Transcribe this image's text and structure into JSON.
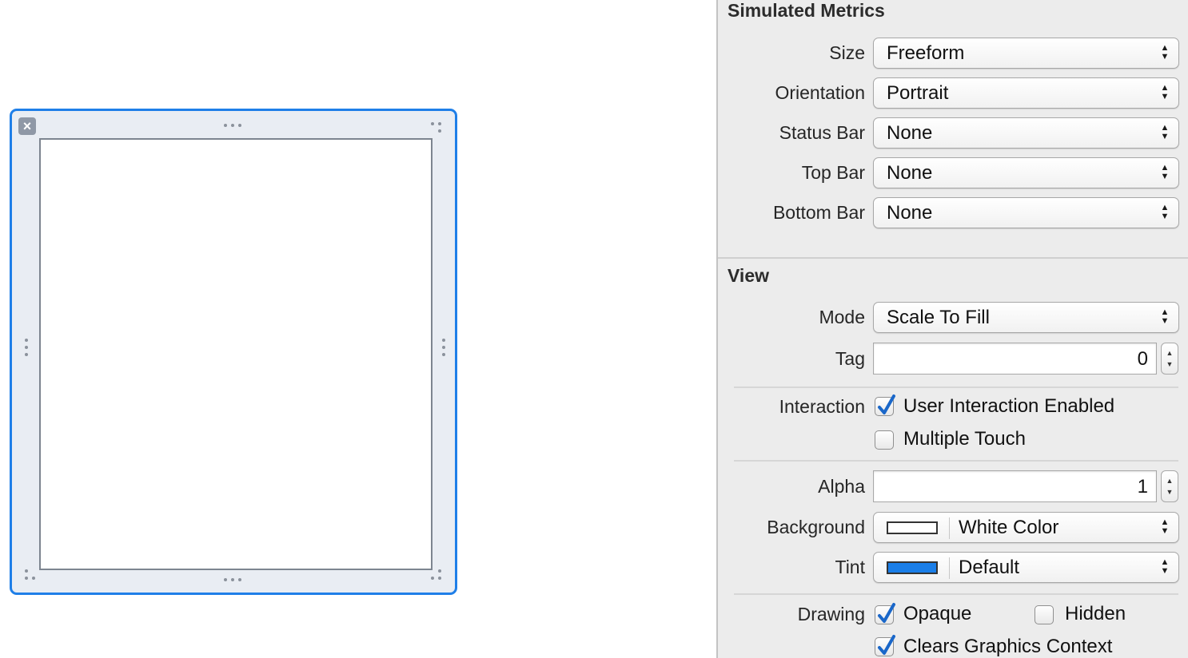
{
  "simulated_metrics": {
    "title": "Simulated Metrics",
    "size": {
      "label": "Size",
      "value": "Freeform"
    },
    "orientation": {
      "label": "Orientation",
      "value": "Portrait"
    },
    "status_bar": {
      "label": "Status Bar",
      "value": "None"
    },
    "top_bar": {
      "label": "Top Bar",
      "value": "None"
    },
    "bottom_bar": {
      "label": "Bottom Bar",
      "value": "None"
    }
  },
  "view": {
    "title": "View",
    "mode": {
      "label": "Mode",
      "value": "Scale To Fill"
    },
    "tag": {
      "label": "Tag",
      "value": "0"
    },
    "interaction": {
      "label": "Interaction",
      "user_interaction_enabled": {
        "label": "User Interaction Enabled",
        "checked": true
      },
      "multiple_touch": {
        "label": "Multiple Touch",
        "checked": false
      }
    },
    "alpha": {
      "label": "Alpha",
      "value": "1"
    },
    "background": {
      "label": "Background",
      "value": "White Color",
      "swatch_color": "#ffffff"
    },
    "tint": {
      "label": "Tint",
      "value": "Default",
      "swatch_color": "#1a7ee8"
    },
    "drawing": {
      "label": "Drawing",
      "opaque": {
        "label": "Opaque",
        "checked": true
      },
      "hidden": {
        "label": "Hidden",
        "checked": false
      },
      "clears_graphics_context": {
        "label": "Clears Graphics Context",
        "checked": true
      }
    }
  },
  "colors": {
    "selection_border": "#1f7fe8",
    "checkmark": "#1a67c9"
  },
  "icons": {
    "close": "close-icon",
    "popup_arrows": "updown-arrows-icon",
    "checkmark": "checkmark-icon"
  }
}
